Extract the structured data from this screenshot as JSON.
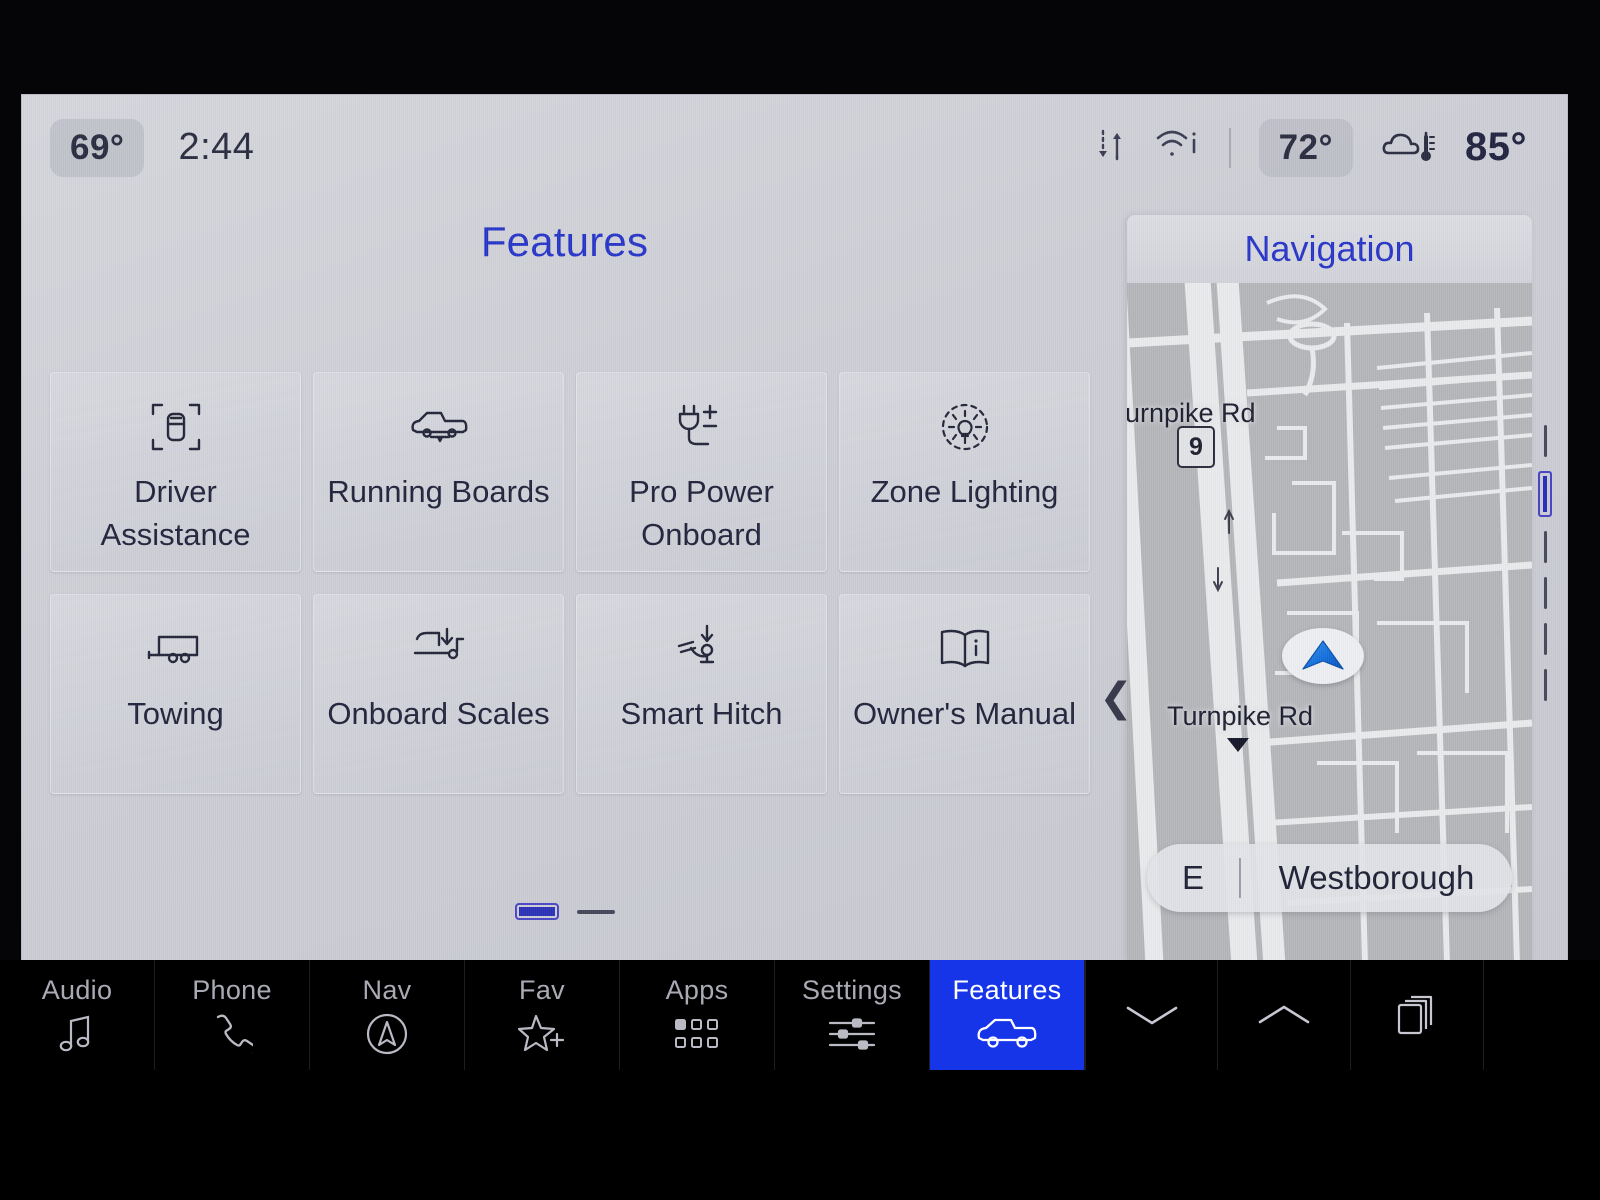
{
  "status_bar": {
    "cabin_temp": "69°",
    "time": "2:44",
    "data_icon": "data-transfer-icon",
    "wifi_icon": "wifi-info-icon",
    "climate_temp": "72°",
    "weather_icon": "cloud-thermometer-icon",
    "outside_temp": "85°"
  },
  "features": {
    "title": "Features",
    "tiles": [
      {
        "label": "Driver Assistance",
        "icon": "car-brackets-icon"
      },
      {
        "label": "Running Boards",
        "icon": "truck-running-boards-icon"
      },
      {
        "label": "Pro Power Onboard",
        "icon": "power-plug-icon"
      },
      {
        "label": "Zone Lighting",
        "icon": "zone-light-icon"
      },
      {
        "label": "Towing",
        "icon": "trailer-icon"
      },
      {
        "label": "Onboard Scales",
        "icon": "scales-truck-icon"
      },
      {
        "label": "Smart Hitch",
        "icon": "smart-hitch-icon"
      },
      {
        "label": "Owner's Manual",
        "icon": "open-book-info-icon"
      }
    ],
    "page_current": 1,
    "page_total": 2
  },
  "navigation": {
    "title": "Navigation",
    "map_labels": {
      "road_top": "urnpike Rd",
      "road_bottom": "Turnpike Rd",
      "highway_shield": "9"
    },
    "destination": {
      "direction": "E",
      "place": "Westborough"
    },
    "collapse_icon": "chevron-left-icon",
    "vehicle_icon": "vehicle-position-arrow-icon"
  },
  "bottom_bar": {
    "tabs": [
      {
        "label": "Audio",
        "icon": "music-note-icon",
        "active": false
      },
      {
        "label": "Phone",
        "icon": "phone-handset-icon",
        "active": false
      },
      {
        "label": "Nav",
        "icon": "compass-arrow-icon",
        "active": false
      },
      {
        "label": "Fav",
        "icon": "star-plus-icon",
        "active": false
      },
      {
        "label": "Apps",
        "icon": "app-grid-icon",
        "active": false
      },
      {
        "label": "Settings",
        "icon": "sliders-icon",
        "active": false
      },
      {
        "label": "Features",
        "icon": "truck-icon",
        "active": true
      }
    ],
    "system_buttons": [
      {
        "icon": "chevron-down-icon"
      },
      {
        "icon": "chevron-up-icon"
      },
      {
        "icon": "stacked-windows-icon"
      }
    ]
  },
  "colors": {
    "accent_blue": "#2836c8",
    "tab_active_blue": "#1735e8",
    "text_dark": "#22243c"
  }
}
